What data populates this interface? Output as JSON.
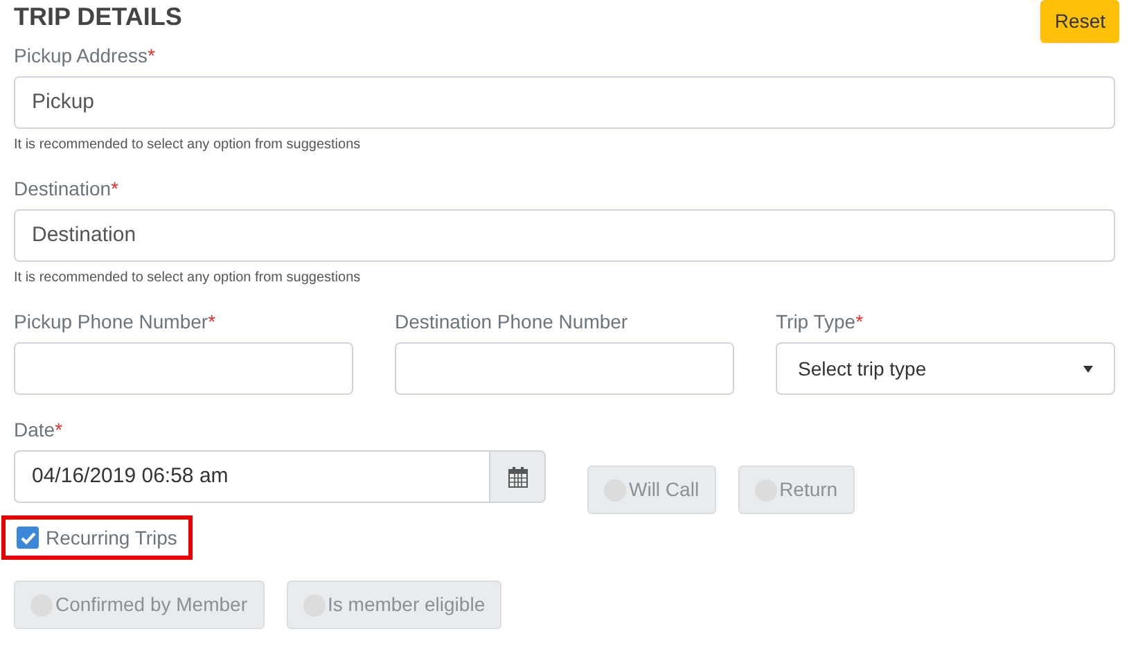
{
  "title": "TRIP DETAILS",
  "reset_button": "Reset",
  "address_fields": [
    {
      "label": "Pickup Address",
      "required_mark": "*",
      "value": "Pickup",
      "hint": "It is recommended to select any option from suggestions"
    },
    {
      "label": "Destination",
      "required_mark": "*",
      "value": "Destination",
      "hint": "It is recommended to select any option from suggestions"
    }
  ],
  "row_fields": [
    {
      "kind": "text",
      "label": "Pickup Phone Number",
      "required_mark": "*"
    },
    {
      "kind": "text",
      "label": "Destination Phone Number"
    },
    {
      "kind": "select",
      "label": "Trip Type",
      "required_mark": "*",
      "value": "Select trip type"
    }
  ],
  "date_field": {
    "label": "Date",
    "required_mark": "*",
    "value": "04/16/2019 06:58 am"
  },
  "date_toggles": [
    {
      "label": "Will Call",
      "on": false
    },
    {
      "label": "Return",
      "on": false
    }
  ],
  "recurring": {
    "label": "Recurring Trips",
    "checked": true,
    "highlighted": true
  },
  "bottom_toggles": [
    {
      "label": "Confirmed by Member",
      "on": false
    },
    {
      "label": "Is member eligible",
      "on": false
    }
  ]
}
